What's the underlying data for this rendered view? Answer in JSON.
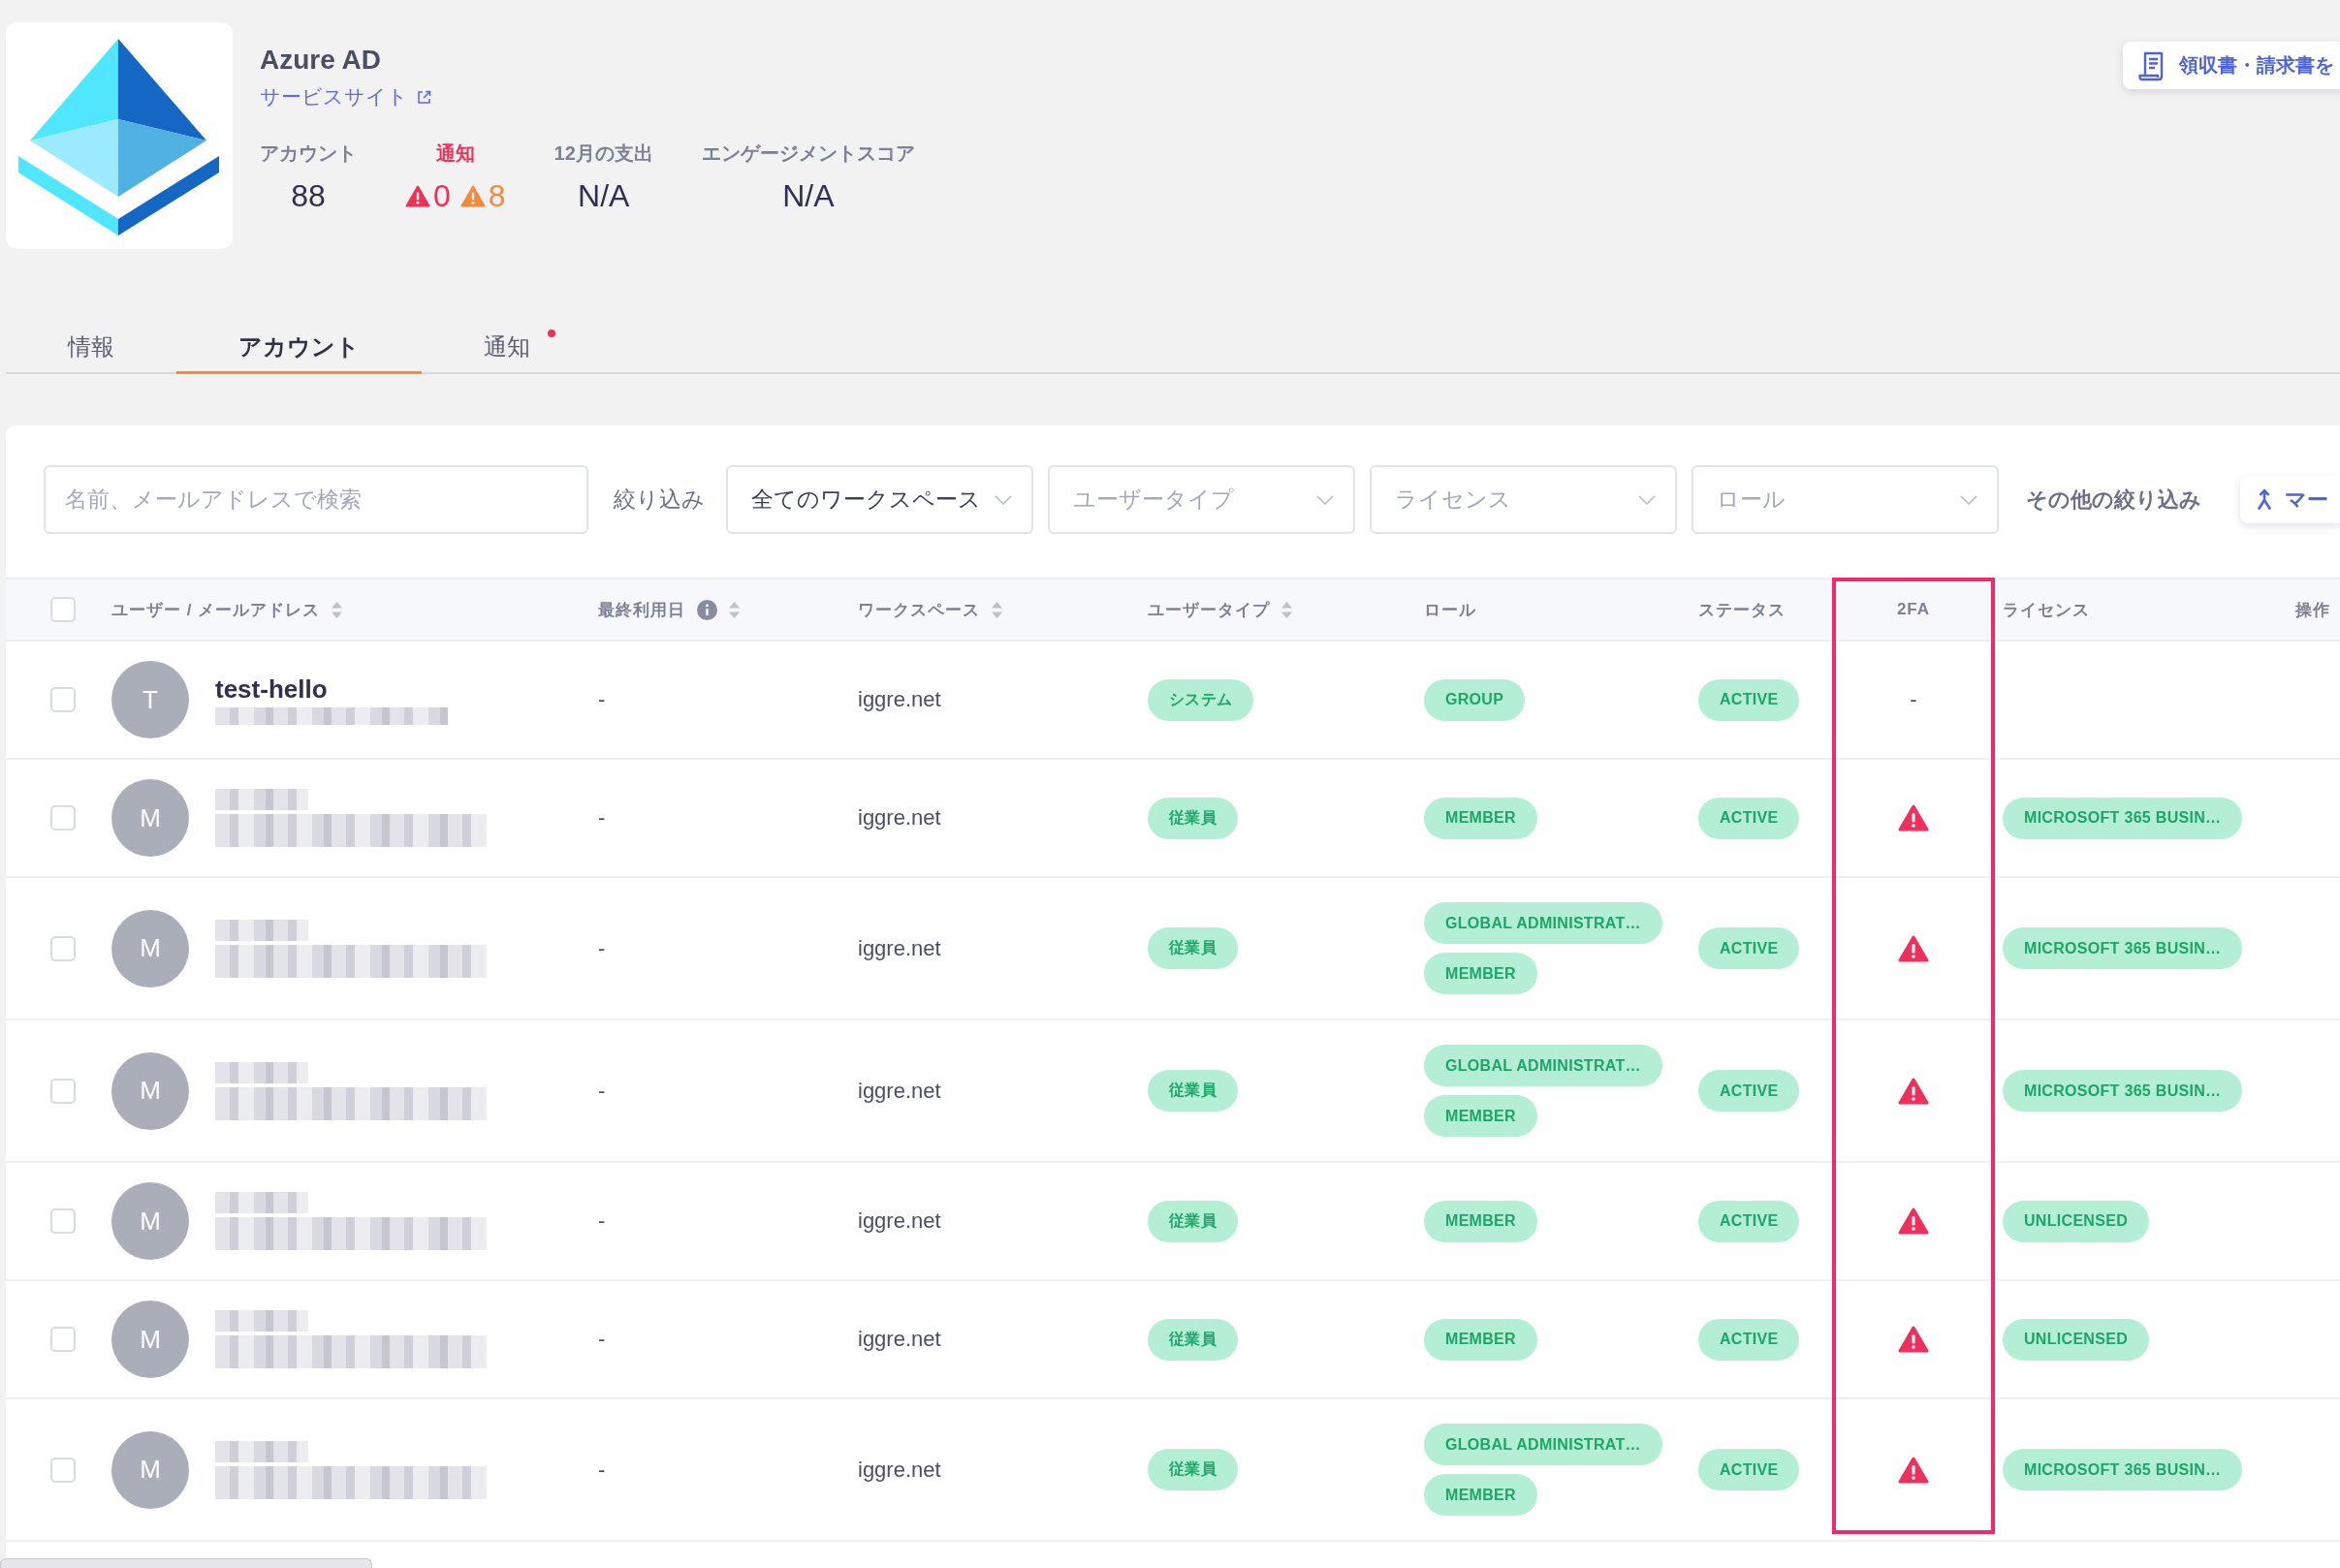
{
  "service": {
    "name": "Azure AD",
    "link": "サービスサイト"
  },
  "receipt_button": "領収書・請求書を",
  "stats": [
    {
      "kind": "value",
      "label": "アカウント",
      "value": "88"
    },
    {
      "kind": "alerts",
      "label": "通知",
      "alerts": [
        {
          "color": "#ef3058",
          "count": "0"
        },
        {
          "color": "#f5893d",
          "count": "8"
        }
      ]
    },
    {
      "kind": "value",
      "label": "12月の支出",
      "value": "N/A"
    },
    {
      "kind": "value",
      "label": "エンゲージメントスコア",
      "value": "N/A"
    }
  ],
  "tabs": [
    {
      "label": "情報",
      "selected": false,
      "dot": false
    },
    {
      "label": "アカウント",
      "selected": true,
      "dot": false
    },
    {
      "label": "通知",
      "selected": false,
      "dot": true
    }
  ],
  "filters": {
    "search": {
      "placeholder": "名前、メールアドレスで検索"
    },
    "label": "絞り込み",
    "dropdowns": [
      {
        "value": "全てのワークスペース"
      },
      {
        "placeholder": "ユーザータイプ"
      },
      {
        "placeholder": "ライセンス"
      },
      {
        "placeholder": "ロール"
      }
    ],
    "more": "その他の絞り込み",
    "merge": "マー"
  },
  "table": {
    "select_all": {
      "checked": false
    },
    "columns": [
      {
        "label": "ユーザー / メールアドレス",
        "sortable": true,
        "info": false,
        "highlighted": false
      },
      {
        "label": "最終利用日",
        "sortable": true,
        "info": true,
        "highlighted": false
      },
      {
        "label": "ワークスペース",
        "sortable": true,
        "info": false,
        "highlighted": false
      },
      {
        "label": "ユーザータイプ",
        "sortable": true,
        "info": false,
        "highlighted": false
      },
      {
        "label": "ロール",
        "sortable": false,
        "info": false,
        "highlighted": false
      },
      {
        "label": "ステータス",
        "sortable": false,
        "info": false,
        "highlighted": false
      },
      {
        "label": "2FA",
        "sortable": false,
        "info": false,
        "highlighted": true
      },
      {
        "label": "ライセンス",
        "sortable": false,
        "info": false,
        "highlighted": false
      },
      {
        "label": "操作",
        "sortable": false,
        "info": false,
        "highlighted": false
      }
    ],
    "rows": [
      {
        "checked": false,
        "avatar": "T",
        "name_hidden": false,
        "name": "test-hello",
        "email_hidden": true,
        "last_used": "-",
        "workspace": "iggre.net",
        "user_type": "システム",
        "roles": [
          "GROUP"
        ],
        "status": "ACTIVE",
        "two_fa_alert": false,
        "two_fa": "-"
      },
      {
        "checked": false,
        "avatar": "M",
        "name_hidden": true,
        "email_hidden": true,
        "last_used": "-",
        "workspace": "iggre.net",
        "user_type": "従業員",
        "roles": [
          "MEMBER"
        ],
        "status": "ACTIVE",
        "two_fa_alert": true,
        "license": "MICROSOFT 365 BUSIN…"
      },
      {
        "checked": false,
        "avatar": "M",
        "name_hidden": true,
        "email_hidden": true,
        "last_used": "-",
        "workspace": "iggre.net",
        "user_type": "従業員",
        "roles": [
          "GLOBAL ADMINISTRAT…",
          "MEMBER"
        ],
        "status": "ACTIVE",
        "two_fa_alert": true,
        "license": "MICROSOFT 365 BUSIN…"
      },
      {
        "checked": false,
        "avatar": "M",
        "name_hidden": true,
        "email_hidden": true,
        "last_used": "-",
        "workspace": "iggre.net",
        "user_type": "従業員",
        "roles": [
          "GLOBAL ADMINISTRAT…",
          "MEMBER"
        ],
        "status": "ACTIVE",
        "two_fa_alert": true,
        "license": "MICROSOFT 365 BUSIN…"
      },
      {
        "checked": false,
        "avatar": "M",
        "name_hidden": true,
        "email_hidden": true,
        "last_used": "-",
        "workspace": "iggre.net",
        "user_type": "従業員",
        "roles": [
          "MEMBER"
        ],
        "status": "ACTIVE",
        "two_fa_alert": true,
        "license": "UNLICENSED"
      },
      {
        "checked": false,
        "avatar": "M",
        "name_hidden": true,
        "email_hidden": true,
        "last_used": "-",
        "workspace": "iggre.net",
        "user_type": "従業員",
        "roles": [
          "MEMBER"
        ],
        "status": "ACTIVE",
        "two_fa_alert": true,
        "license": "UNLICENSED"
      },
      {
        "checked": false,
        "avatar": "M",
        "name_hidden": true,
        "email_hidden": true,
        "last_used": "-",
        "workspace": "iggre.net",
        "user_type": "従業員",
        "roles": [
          "GLOBAL ADMINISTRAT…",
          "MEMBER"
        ],
        "status": "ACTIVE",
        "two_fa_alert": true,
        "license": "MICROSOFT 365 BUSIN…"
      }
    ]
  }
}
